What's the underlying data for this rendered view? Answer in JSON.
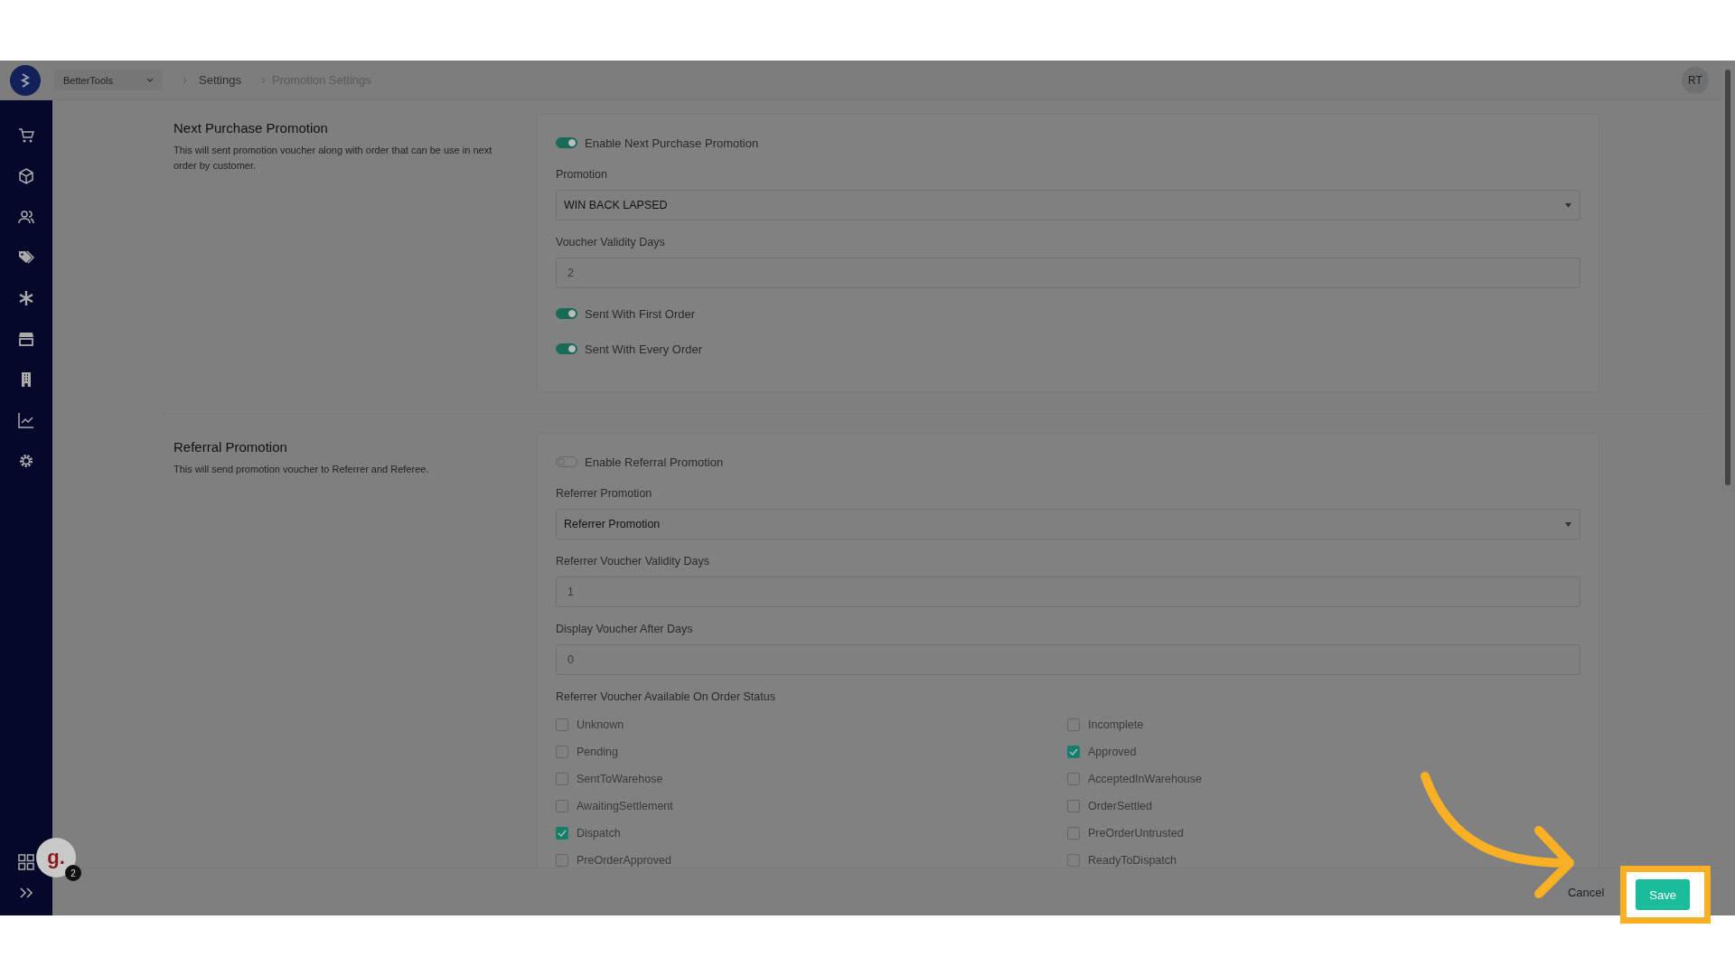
{
  "header": {
    "workspace": "BetterTools",
    "breadcrumbs": [
      {
        "label": "Settings",
        "current": false
      },
      {
        "label": "Promotion Settings",
        "current": true
      }
    ],
    "avatar": "RT"
  },
  "sections": [
    {
      "title": "Next Purchase Promotion",
      "description": "This will sent promotion voucher along with order that can be use in next order by customer.",
      "fields": [
        {
          "kind": "toggle",
          "label": "Enable Next Purchase Promotion",
          "on": true
        },
        {
          "kind": "select",
          "label": "Promotion",
          "value": "WIN BACK LAPSED"
        },
        {
          "kind": "input",
          "label": "Voucher Validity Days",
          "value": "2"
        },
        {
          "kind": "toggle",
          "label": "Sent With First Order",
          "on": true
        },
        {
          "kind": "toggle",
          "label": "Sent With Every Order",
          "on": true
        }
      ]
    },
    {
      "title": "Referral Promotion",
      "description": "This will send promotion voucher to Referrer and Referee.",
      "fields": [
        {
          "kind": "toggle",
          "label": "Enable Referral Promotion",
          "on": false
        },
        {
          "kind": "select",
          "label": "Referrer Promotion",
          "value": "Referrer Promotion"
        },
        {
          "kind": "input",
          "label": "Referrer Voucher Validity Days",
          "value": "1"
        },
        {
          "kind": "input",
          "label": "Display Voucher After Days",
          "value": "0"
        },
        {
          "kind": "checkboxes",
          "label": "Referrer Voucher Available On Order Status",
          "options": [
            {
              "label": "Unknown",
              "checked": false
            },
            {
              "label": "Incomplete",
              "checked": false
            },
            {
              "label": "Pending",
              "checked": false
            },
            {
              "label": "Approved",
              "checked": true
            },
            {
              "label": "SentToWarehose",
              "checked": false
            },
            {
              "label": "AcceptedInWarehouse",
              "checked": false
            },
            {
              "label": "AwaitingSettlement",
              "checked": false
            },
            {
              "label": "OrderSettled",
              "checked": false
            },
            {
              "label": "Dispatch",
              "checked": true
            },
            {
              "label": "PreOrderUntrusted",
              "checked": false
            },
            {
              "label": "PreOrderApproved",
              "checked": false
            },
            {
              "label": "ReadyToDispatch",
              "checked": false
            }
          ]
        }
      ]
    }
  ],
  "footer": {
    "buttons": [
      {
        "label": "Cancel",
        "kind": "secondary"
      },
      {
        "label": "Save",
        "kind": "primary"
      }
    ]
  },
  "helper": {
    "initial": "g.",
    "badge": "2"
  }
}
